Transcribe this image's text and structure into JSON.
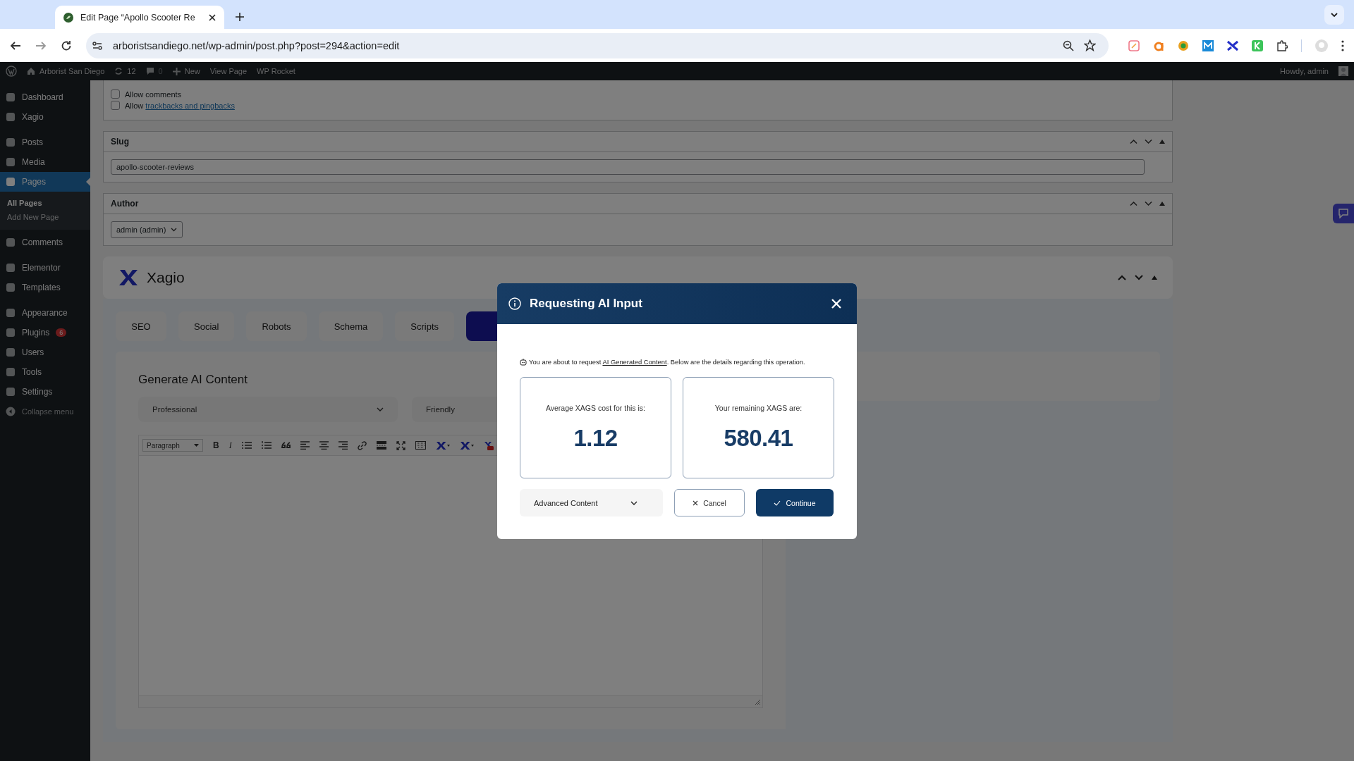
{
  "browser": {
    "tab_title": "Edit Page “Apollo Scooter Re",
    "url": "arboristsandiego.net/wp-admin/post.php?post=294&action=edit"
  },
  "admin_bar": {
    "site_name": "Arborist San Diego",
    "updates": "12",
    "comments": "0",
    "new_label": "New",
    "links": [
      "View Page",
      "WP Rocket"
    ],
    "greeting": "Howdy, admin"
  },
  "sidebar": {
    "items": [
      {
        "label": "Dashboard",
        "selected": false
      },
      {
        "label": "Xagio",
        "selected": false
      },
      {
        "label": "Posts",
        "selected": false
      },
      {
        "label": "Media",
        "selected": false
      },
      {
        "label": "Pages",
        "selected": true,
        "children": [
          {
            "label": "All Pages",
            "selected": true
          },
          {
            "label": "Add New Page",
            "selected": false
          }
        ]
      },
      {
        "label": "Comments",
        "selected": false
      },
      {
        "label": "Elementor",
        "selected": false
      },
      {
        "label": "Templates",
        "selected": false
      },
      {
        "label": "Appearance",
        "selected": false
      },
      {
        "label": "Plugins",
        "selected": false,
        "badge": "6"
      },
      {
        "label": "Users",
        "selected": false
      },
      {
        "label": "Tools",
        "selected": false
      },
      {
        "label": "Settings",
        "selected": false
      },
      {
        "label": "Collapse menu",
        "selected": false,
        "kind": "collapse"
      }
    ]
  },
  "discussion": {
    "options": [
      {
        "label": "Allow comments",
        "checked": false
      },
      {
        "label": "Allow",
        "link": "trackbacks and pingbacks",
        "checked": false
      }
    ]
  },
  "slug": {
    "title": "Slug",
    "value": "apollo-scooter-reviews"
  },
  "author": {
    "title": "Author",
    "value": "admin (admin)"
  },
  "xagio": {
    "brand": "Xagio",
    "tabs": [
      {
        "label": "SEO",
        "selected": false
      },
      {
        "label": "Social",
        "selected": false
      },
      {
        "label": "Robots",
        "selected": false
      },
      {
        "label": "Schema",
        "selected": false
      },
      {
        "label": "Scripts",
        "selected": false
      },
      {
        "selected": true
      }
    ],
    "generator": {
      "title": "Generate AI Content",
      "tone": "Professional",
      "style": "Friendly",
      "format": "Paragraph",
      "toolbar_text": [
        "B",
        "I"
      ]
    }
  },
  "dialog": {
    "title": "Requesting AI Input",
    "notice": "You are about to request",
    "notice_link": "AI Generated Content",
    "notice_after": ". Below are the details regarding this operation.",
    "cards": [
      {
        "label": "Average XAGS cost for this is:",
        "value": "1.12"
      },
      {
        "label": "Your remaining XAGS are:",
        "value": "580.41"
      }
    ],
    "select": "Advanced Content",
    "cancel": "Cancel",
    "continue": "Continue"
  }
}
